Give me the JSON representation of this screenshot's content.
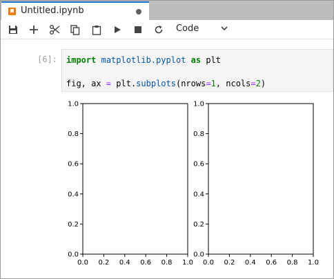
{
  "tab": {
    "title": "Untitled.ipynb",
    "icon": "notebook-icon"
  },
  "toolbar": {
    "buttons": [
      "save-icon",
      "add-icon",
      "cut-icon",
      "copy-icon",
      "paste-icon",
      "run-icon",
      "stop-icon",
      "restart-icon"
    ],
    "cell_type": "Code"
  },
  "cell": {
    "prompt": "[6]:",
    "line1": {
      "kw1": "import",
      "mod": "matplotlib.pyplot",
      "kw2": "as",
      "name": "plt"
    },
    "line2": {
      "lhs": "fig, ax ",
      "eq": "=",
      "plt": "plt.",
      "fn": "subplots",
      "open": "(nrows",
      "eq1": "=",
      "n1": "1",
      "mid": ", ncols",
      "eq2": "=",
      "n2": "2",
      "close": ")"
    }
  },
  "chart_data": [
    {
      "type": "scatter",
      "series": [],
      "xlim": [
        0.0,
        1.0
      ],
      "ylim": [
        0.0,
        1.0
      ],
      "x_ticks": [
        "0.0",
        "0.2",
        "0.4",
        "0.6",
        "0.8",
        "1.0"
      ],
      "y_ticks": [
        "0.0",
        "0.2",
        "0.4",
        "0.6",
        "0.8",
        "1.0"
      ],
      "title": "",
      "xlabel": "",
      "ylabel": "",
      "grid": false
    },
    {
      "type": "scatter",
      "series": [],
      "xlim": [
        0.0,
        1.0
      ],
      "ylim": [
        0.0,
        1.0
      ],
      "x_ticks": [
        "0.0",
        "0.2",
        "0.4",
        "0.6",
        "0.8",
        "1.0"
      ],
      "y_ticks": [
        "0.0",
        "0.2",
        "0.4",
        "0.6",
        "0.8",
        "1.0"
      ],
      "title": "",
      "xlabel": "",
      "ylabel": "",
      "grid": false
    }
  ]
}
